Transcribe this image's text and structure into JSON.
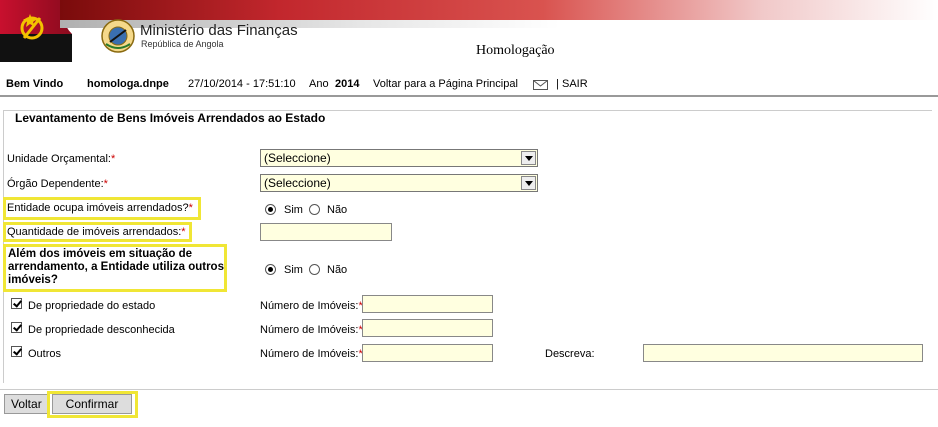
{
  "header": {
    "ministry": "Ministério das Finanças",
    "republic": "República de Angola",
    "environment": "Homologação"
  },
  "topbar": {
    "welcome": "Bem Vindo",
    "user": "homologa.dnpe",
    "datetime": "27/10/2014 - 17:51:10",
    "year_label": "Ano",
    "year_value": "2014",
    "home_link": "Voltar para a Página Principal",
    "separator": "|",
    "logout": "SAIR"
  },
  "form": {
    "legend": "Levantamento de Bens Imóveis Arrendados ao Estado",
    "unidade_label": "Unidade Orçamental:",
    "unidade_value": "(Seleccione)",
    "orgao_label": "Órgão Dependente:",
    "orgao_value": "(Seleccione)",
    "ocupa_label": "Entidade ocupa imóveis arrendados?",
    "sim": "Sim",
    "nao": "Não",
    "quantidade_label": "Quantidade de imóveis arrendados:",
    "quantidade_value": "",
    "alem_label_1": "Além dos imóveis em situação de",
    "alem_label_2": "arrendamento, a Entidade utiliza outros",
    "alem_label_3": "imóveis?",
    "asterisk": "*",
    "options": [
      {
        "label": "De propriedade do estado",
        "num_label": "Número de Imóveis:",
        "value": ""
      },
      {
        "label": "De propriedade desconhecida",
        "num_label": "Número de Imóveis:",
        "value": ""
      },
      {
        "label": "Outros",
        "num_label": "Número de Imóveis:",
        "value": ""
      }
    ],
    "descreva_label": "Descreva:",
    "descreva_value": ""
  },
  "buttons": {
    "back": "Voltar",
    "confirm": "Confirmar"
  }
}
